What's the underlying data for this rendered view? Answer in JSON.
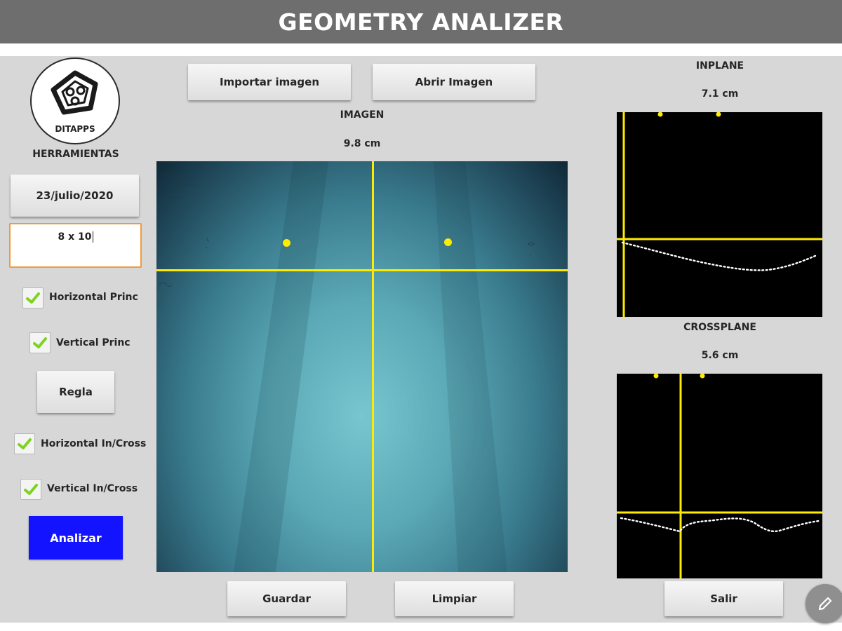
{
  "app": {
    "title": "GEOMETRY ANALIZER"
  },
  "sidebar": {
    "logo_text": "DITAPPS",
    "tools_label": "HERRAMIENTAS",
    "date_button": "23/julio/2020",
    "size_input_value": "8 x 10",
    "checkboxes": [
      {
        "label": "Horizontal Princ",
        "checked": true
      },
      {
        "label": "Vertical Princ",
        "checked": true
      },
      {
        "label": "Horizontal In/Cross",
        "checked": true
      },
      {
        "label": "Vertical In/Cross",
        "checked": true
      }
    ],
    "ruler_button": "Regla",
    "analyze_button": "Analizar"
  },
  "image_panel": {
    "import_button": "Importar imagen",
    "open_button": "Abrir Imagen",
    "title": "IMAGEN",
    "size": "9.8 cm",
    "save_button": "Guardar",
    "clear_button": "Limpiar"
  },
  "inplane": {
    "title": "INPLANE",
    "size": "7.1 cm"
  },
  "crossplane": {
    "title": "CROSSPLANE",
    "size": "5.6 cm"
  },
  "exit_button": "Salir",
  "colors": {
    "title_bar": "#6e6e6e",
    "panel": "#d7d7d7",
    "analyze": "#1313ff",
    "input_border": "#f39a38",
    "marker": "#ffeb00",
    "check": "#7ed321"
  },
  "icons": {
    "checkbox": "check-icon",
    "logo": "pentagon-logo",
    "fab": "pencil-icon"
  }
}
